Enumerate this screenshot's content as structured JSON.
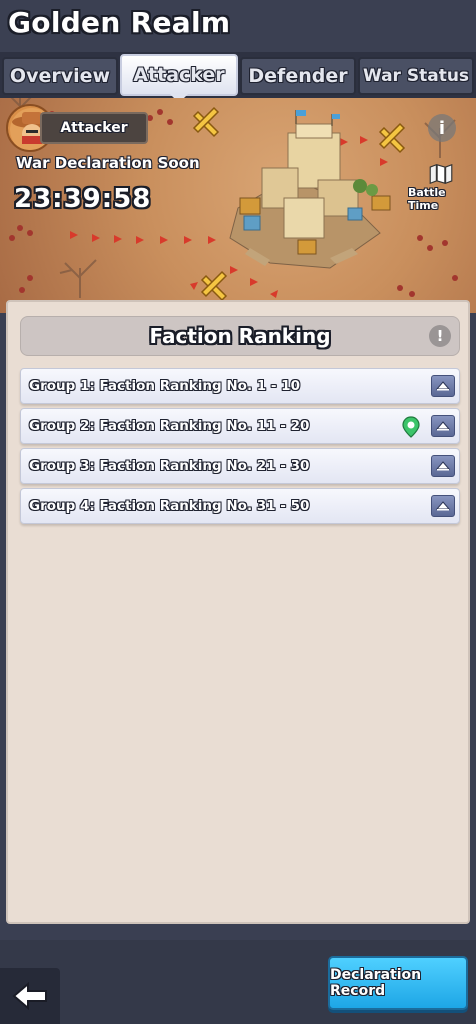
{
  "header": {
    "title": "Golden Realm"
  },
  "tabs": [
    {
      "label": "Overview",
      "active": false
    },
    {
      "label": "Attacker",
      "active": true
    },
    {
      "label": "Defender",
      "active": false
    },
    {
      "label": "War Status",
      "active": false
    }
  ],
  "map": {
    "role_badge": "Attacker",
    "war_status": "War Declaration Soon",
    "countdown": "23:39:58",
    "battle_time_label": "Battle Time",
    "info_icon": "info-icon"
  },
  "ranking": {
    "title": "Faction Ranking",
    "groups": [
      {
        "label": "Group 1: Faction Ranking No. 1 - 10",
        "pinned": false
      },
      {
        "label": "Group 2: Faction Ranking No. 11 - 20",
        "pinned": true
      },
      {
        "label": "Group 3: Faction Ranking No. 21 - 30",
        "pinned": false
      },
      {
        "label": "Group 4: Faction Ranking No. 31 - 50",
        "pinned": false
      }
    ]
  },
  "footer": {
    "back_icon": "back-arrow-icon",
    "declaration_button": "Declaration Record"
  },
  "colors": {
    "accent_blue": "#1ea6e6",
    "pin_green": "#3cc46a",
    "panel_bg": "#e9ddd3"
  }
}
